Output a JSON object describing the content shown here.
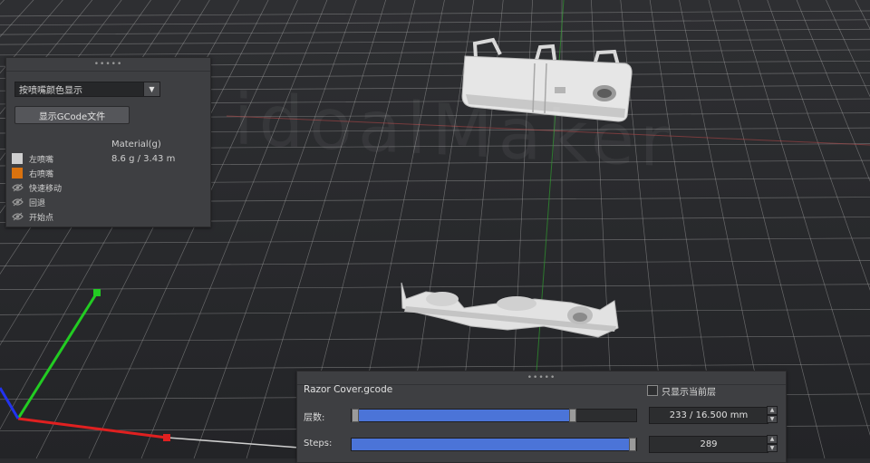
{
  "watermark": "idoalMaker",
  "left_panel": {
    "display_mode": "按喷嘴颜色显示",
    "show_gcode_button": "显示GCode文件",
    "material_label": "Material(g)",
    "material_value": "8.6 g / 3.43 m",
    "legend": [
      {
        "label": "左喷嘴",
        "icon": "swatch",
        "color": "#cfcfcf"
      },
      {
        "label": "右喷嘴",
        "icon": "swatch",
        "color": "#d9720f"
      },
      {
        "label": "快速移动",
        "icon": "eye-icon"
      },
      {
        "label": "回退",
        "icon": "eye-icon"
      },
      {
        "label": "开始点",
        "icon": "eye-icon"
      }
    ]
  },
  "bottom_panel": {
    "file_name": "Razor Cover.gcode",
    "layer_only_label": "只显示当前层",
    "layers_label": "层数:",
    "layers_value": "233 / 16.500 mm",
    "layers_progress": 0.79,
    "steps_label": "Steps:",
    "steps_value": "289",
    "steps_progress": 1.0
  },
  "colors": {
    "accent_fill": "#4b74d8",
    "axis_x": "#e02020",
    "axis_y": "#22cc22",
    "axis_z": "#2233ee"
  }
}
